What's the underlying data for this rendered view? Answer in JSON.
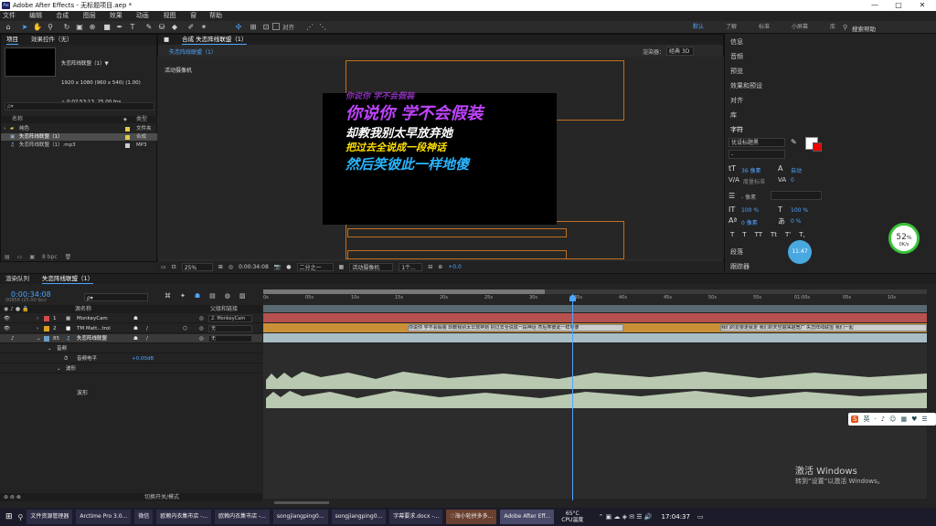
{
  "titlebar": {
    "app_icon": "Ae",
    "title": "Adobe After Effects - 无标题项目.aep *",
    "minimize": "—",
    "maximize": "□",
    "close": "✕"
  },
  "menu": [
    "文件(F)",
    "编辑(E)",
    "合成(C)",
    "图层(L)",
    "效果(T)",
    "动画(A)",
    "视图(V)",
    "窗口",
    "帮助(H)"
  ],
  "toolbar": {
    "align_label": "对齐"
  },
  "workspace": {
    "items": [
      "默认",
      "了解",
      "标准",
      "小屏幕",
      "库"
    ],
    "active": "默认",
    "search": "搜索帮助"
  },
  "project": {
    "tabs": [
      "项目",
      "效果控件（无）"
    ],
    "comp_name": "失恋阵线联盟（1）▼",
    "comp_info_1": "1920 x 1080 (960 x 540) (1.00)",
    "comp_info_2": "△ 0:02:53:13, 25.00 fps",
    "search_placeholder": "ρ▾",
    "columns": {
      "name": "名称",
      "type": "类型"
    },
    "rows": [
      {
        "name": "纯色",
        "type": "文件夹",
        "color": "#e6c84a"
      },
      {
        "name": "失恋阵线联盟（1）",
        "type": "合成",
        "color": "#e6c84a"
      },
      {
        "name": "失恋阵线联盟（1）.mp3",
        "type": "MP3",
        "color": "#cccccc"
      }
    ]
  },
  "comp": {
    "tab": "合成 失恋阵线联盟（1）",
    "subtab": "失恋阵线联盟（1）",
    "renderer_label": "渲染器：",
    "renderer": "经典 3D",
    "camera_label": "活动摄像机",
    "lyrics": [
      {
        "text": "你说你  学不会假装",
        "color": "#c044ff"
      },
      {
        "text": "却教我别太早放弃她",
        "color": "#ffffff"
      },
      {
        "text": "把过去全说成一段神话",
        "color": "#ffe000"
      },
      {
        "text": "然后笑彼此一样地傻",
        "color": "#29b6ff"
      }
    ],
    "top_partial_line": "你说你  学不会假装"
  },
  "compbar": {
    "zoom": "25%",
    "time": "0:00:34:08",
    "resolution": "二分之一",
    "camera": "活动摄像机",
    "views": "1个...",
    "exposure": "+0.0"
  },
  "right_panel": {
    "sections": [
      "信息",
      "音频",
      "预览",
      "效果和预设",
      "对齐",
      "库",
      "字符",
      "段落",
      "跟踪器"
    ],
    "font": "优设标题黑",
    "font_size": "36 像素",
    "leading": "自动",
    "tracking_label": "度量标准",
    "tracking_value": "0",
    "stroke": "- 像素",
    "vscale": "100 %",
    "hscale": "100 %",
    "baseline": "0 像素",
    "tsume": "0 %",
    "styles": [
      "T",
      "T",
      "TT",
      "Tt",
      "T'",
      "T,"
    ]
  },
  "cpu_widget": {
    "percent": "52",
    "unit": "%",
    "label": "0K/s"
  },
  "circle_widget": {
    "label": "11:47"
  },
  "timeline": {
    "tabs": [
      "渲染队列",
      "失恋阵线联盟（1）"
    ],
    "timecode": "0:00:34:08",
    "timecode_sub": "00858 (25.00 fps)",
    "search_placeholder": "ρ▾",
    "column_headers": {
      "source": "源名称",
      "parent": "父级和链接"
    },
    "layers": [
      {
        "num": "1",
        "name": "MonkeyCam",
        "parent": "2. MonkeyCam",
        "color": "#d44a4a"
      },
      {
        "num": "2",
        "name": "TM Matt...trol",
        "parent": "无",
        "color": "#e0a020"
      },
      {
        "num": "85",
        "name": "失恋阵线联盟",
        "parent": "无",
        "color": "#6aa2c8"
      }
    ],
    "sub_audio": "音频",
    "sub_level_label": "音频电平",
    "sub_level_value": "+0.00dB",
    "sub_wave": "波形",
    "wave_label": "波形",
    "ticks": [
      "0s",
      "05s",
      "10s",
      "15s",
      "20s",
      "25s",
      "30s",
      "35s",
      "40s",
      "45s",
      "50s",
      "55s",
      "01:00s",
      "05s",
      "10s"
    ],
    "bottom_label": "切换开关/模式",
    "clip_texts_a": "你说你  学不会假装  却教我别太早放弃她  把过去全说成一段神话  然后笑彼此一样地傻",
    "clip_texts_b": "我们的爱要走就走  我们的天空越来越宽广  失恋阵线联盟  我们一起"
  },
  "sogou": {
    "items": [
      "S",
      "英",
      "·",
      "♪",
      "☺",
      "▦",
      "♥",
      "☰"
    ]
  },
  "watermark": {
    "line1": "激活 Windows",
    "line2": "转到“设置”以激活 Windows。"
  },
  "taskbar": {
    "items": [
      "文件资源管理器",
      "Arctime Pro 3.0...",
      "微信",
      "欧赖内衣集市店 -...",
      "欧赖内衣集市店 -...",
      "songjiangping0...",
      "songjiangping0...",
      "字幕要求.docx -...",
      "♡海小轮拼多多...",
      "Adobe After Eff..."
    ],
    "temp": "65°C",
    "temp_label": "CPU温度",
    "clock": "17:04:37"
  },
  "colors": {
    "accent": "#4fa4ff",
    "guide": "#c07020",
    "waveform": "#b9c8b0"
  }
}
